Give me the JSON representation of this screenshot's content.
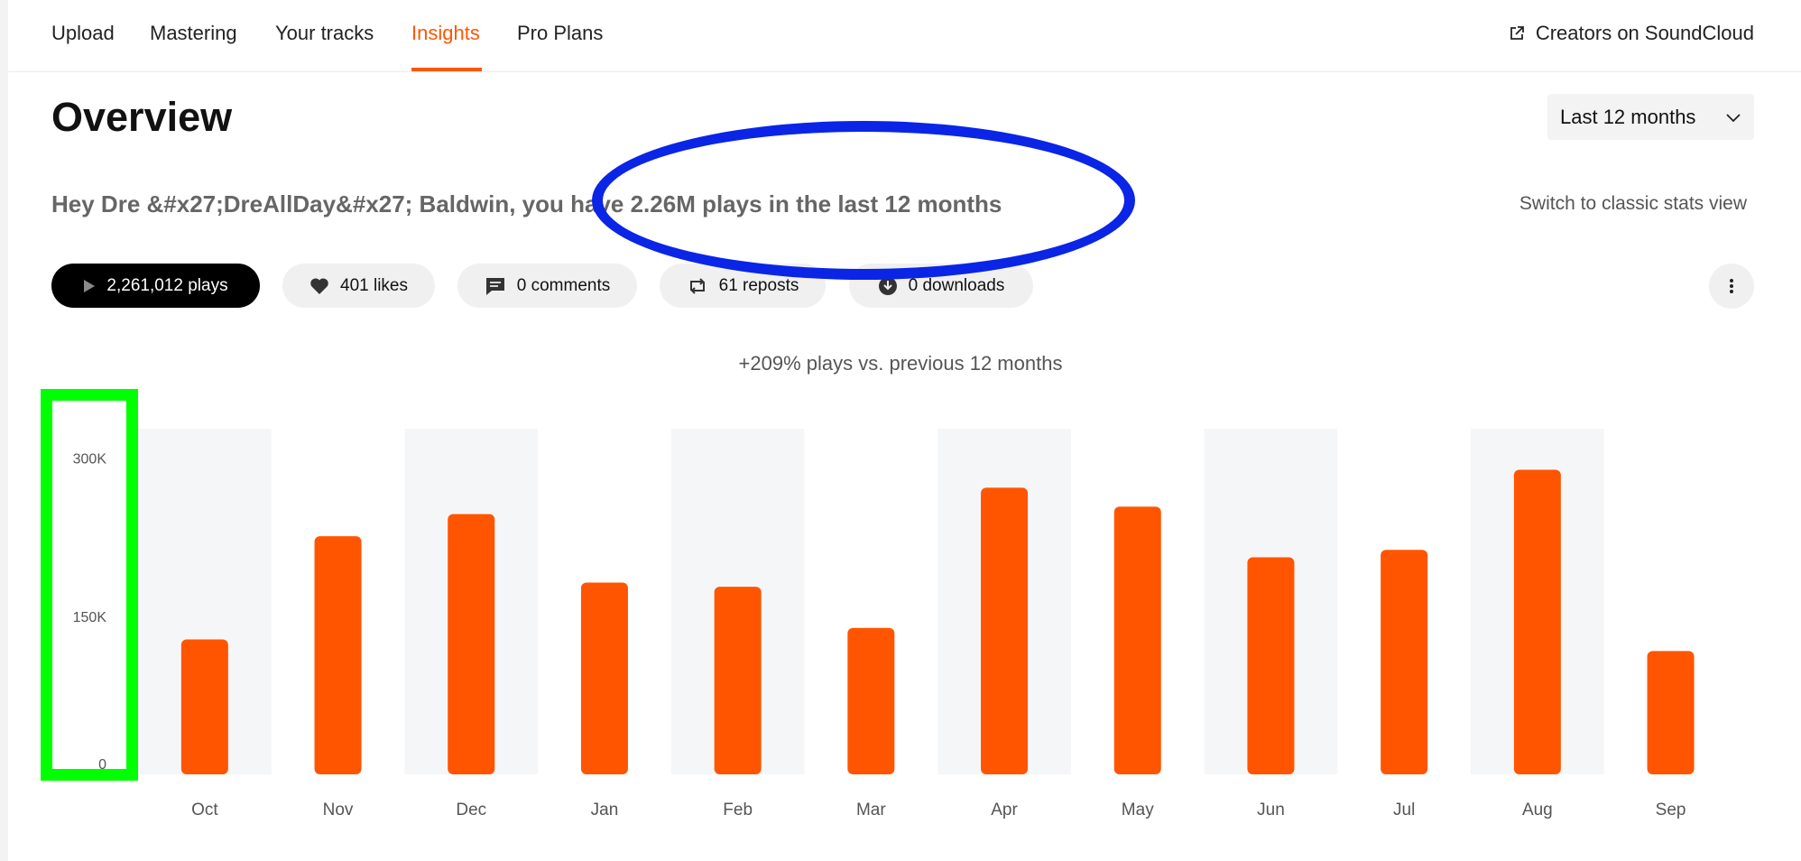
{
  "nav": {
    "items": [
      {
        "label": "Upload"
      },
      {
        "label": "Mastering"
      },
      {
        "label": "Your tracks"
      },
      {
        "label": "Insights",
        "active": true
      },
      {
        "label": "Pro Plans"
      }
    ],
    "creators_link": "Creators on SoundCloud"
  },
  "overview": {
    "title": "Overview",
    "range_selected": "Last 12 months",
    "greeting": "Hey Dre &#x27;DreAllDay&#x27; Baldwin, you have 2.26M plays in the last 12 months",
    "switch_link": "Switch to classic stats view"
  },
  "stats": [
    {
      "icon": "play-icon",
      "label": "2,261,012 plays",
      "active": true
    },
    {
      "icon": "heart-icon",
      "label": "401 likes"
    },
    {
      "icon": "comment-icon",
      "label": "0 comments"
    },
    {
      "icon": "repost-icon",
      "label": "61 reposts"
    },
    {
      "icon": "download-icon",
      "label": "0 downloads"
    }
  ],
  "comparison": "+209% plays vs. previous 12 months",
  "colors": {
    "accent": "#ff5500",
    "bar": "#ff5500",
    "band": "#f5f6f8",
    "annotation_ellipse": "#0a25e6",
    "annotation_rect": "#00ff00"
  },
  "chart_data": {
    "type": "bar",
    "categories": [
      "Oct",
      "Nov",
      "Dec",
      "Jan",
      "Feb",
      "Mar",
      "Apr",
      "May",
      "Jun",
      "Jul",
      "Aug",
      "Sep"
    ],
    "values": [
      128000,
      226000,
      247000,
      182000,
      178000,
      139000,
      272000,
      254000,
      206000,
      213000,
      289000,
      117000
    ],
    "ylim": [
      0,
      328000
    ],
    "yticks": [
      {
        "value": 0,
        "label": "0"
      },
      {
        "value": 150000,
        "label": "150K"
      },
      {
        "value": 300000,
        "label": "300K"
      }
    ],
    "alternating_bands": true,
    "grid": false
  }
}
